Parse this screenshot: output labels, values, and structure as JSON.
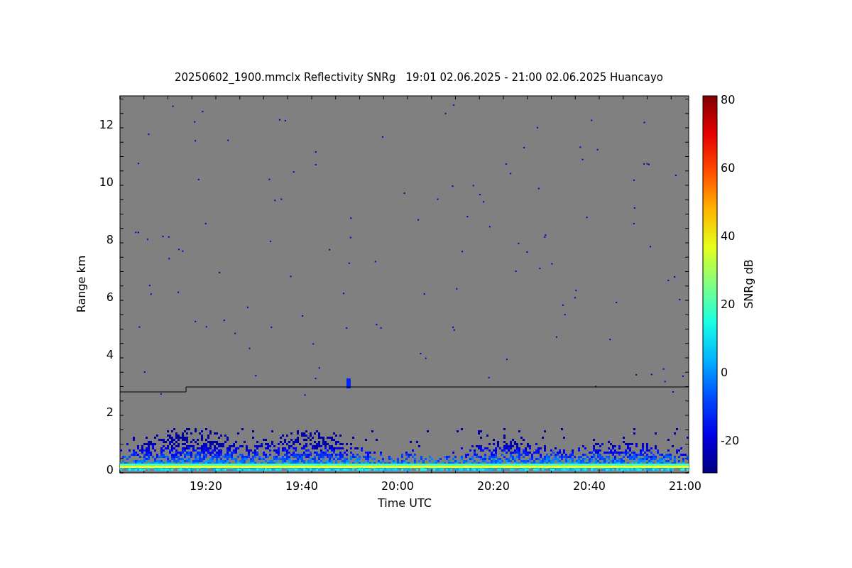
{
  "title": "20250602_1900.mmclx Reflectivity SNRg   19:01 02.06.2025 - 21:00 02.06.2025 Huancayo",
  "y_axis": {
    "label": "Range km",
    "ticks": [
      "12",
      "10",
      "8",
      "6",
      "4",
      "2",
      "0"
    ]
  },
  "x_axis": {
    "label": "Time UTC",
    "ticks": [
      "19:20",
      "19:40",
      "20:00",
      "20:20",
      "20:40",
      "21:00"
    ]
  },
  "colorbar": {
    "label": "SNRg dB",
    "ticks": [
      "80",
      "60",
      "40",
      "20",
      "0",
      "-20"
    ]
  }
}
